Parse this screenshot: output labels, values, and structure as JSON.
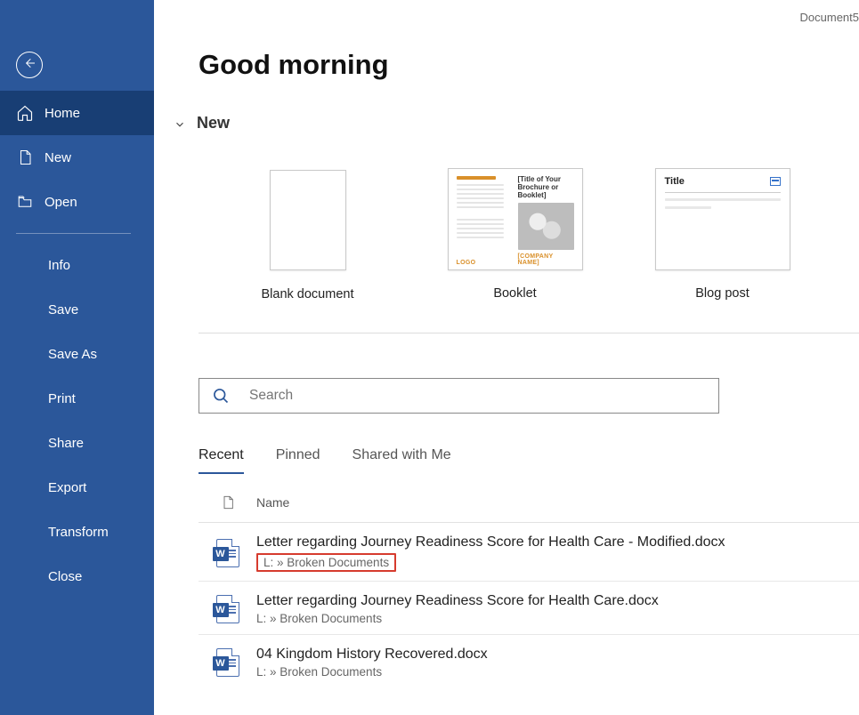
{
  "header": {
    "document_title": "Document5"
  },
  "sidebar": {
    "nav": [
      {
        "id": "home",
        "label": "Home",
        "icon": "home-icon",
        "active": true
      },
      {
        "id": "new",
        "label": "New",
        "icon": "new-icon",
        "active": false
      },
      {
        "id": "open",
        "label": "Open",
        "icon": "open-icon",
        "active": false
      }
    ],
    "sub": [
      {
        "id": "info",
        "label": "Info"
      },
      {
        "id": "save",
        "label": "Save"
      },
      {
        "id": "save_as",
        "label": "Save As"
      },
      {
        "id": "print",
        "label": "Print"
      },
      {
        "id": "share",
        "label": "Share"
      },
      {
        "id": "export",
        "label": "Export"
      },
      {
        "id": "transform",
        "label": "Transform"
      },
      {
        "id": "close",
        "label": "Close"
      }
    ]
  },
  "main": {
    "greeting": "Good morning",
    "new_section": {
      "label": "New",
      "templates": [
        {
          "id": "blank",
          "caption": "Blank document"
        },
        {
          "id": "booklet",
          "caption": "Booklet",
          "preview": {
            "title": "[Title of Your Brochure or Booklet]",
            "subtitle": "[COMPANY NAME]",
            "logo": "LOGO"
          }
        },
        {
          "id": "blog",
          "caption": "Blog post",
          "preview": {
            "title": "Title"
          }
        }
      ]
    },
    "search": {
      "placeholder": "Search"
    },
    "tabs": [
      {
        "id": "recent",
        "label": "Recent",
        "active": true
      },
      {
        "id": "pinned",
        "label": "Pinned",
        "active": false
      },
      {
        "id": "shared",
        "label": "Shared with Me",
        "active": false
      }
    ],
    "list": {
      "columns": {
        "name": "Name"
      },
      "rows": [
        {
          "filename": "Letter regarding Journey Readiness Score for Health Care - Modified.docx",
          "path": "L: » Broken Documents",
          "highlight": true
        },
        {
          "filename": "Letter regarding Journey Readiness Score for Health Care.docx",
          "path": "L: » Broken Documents",
          "highlight": false
        },
        {
          "filename": "04 Kingdom History Recovered.docx",
          "path": "L: » Broken Documents",
          "highlight": false
        }
      ]
    }
  }
}
